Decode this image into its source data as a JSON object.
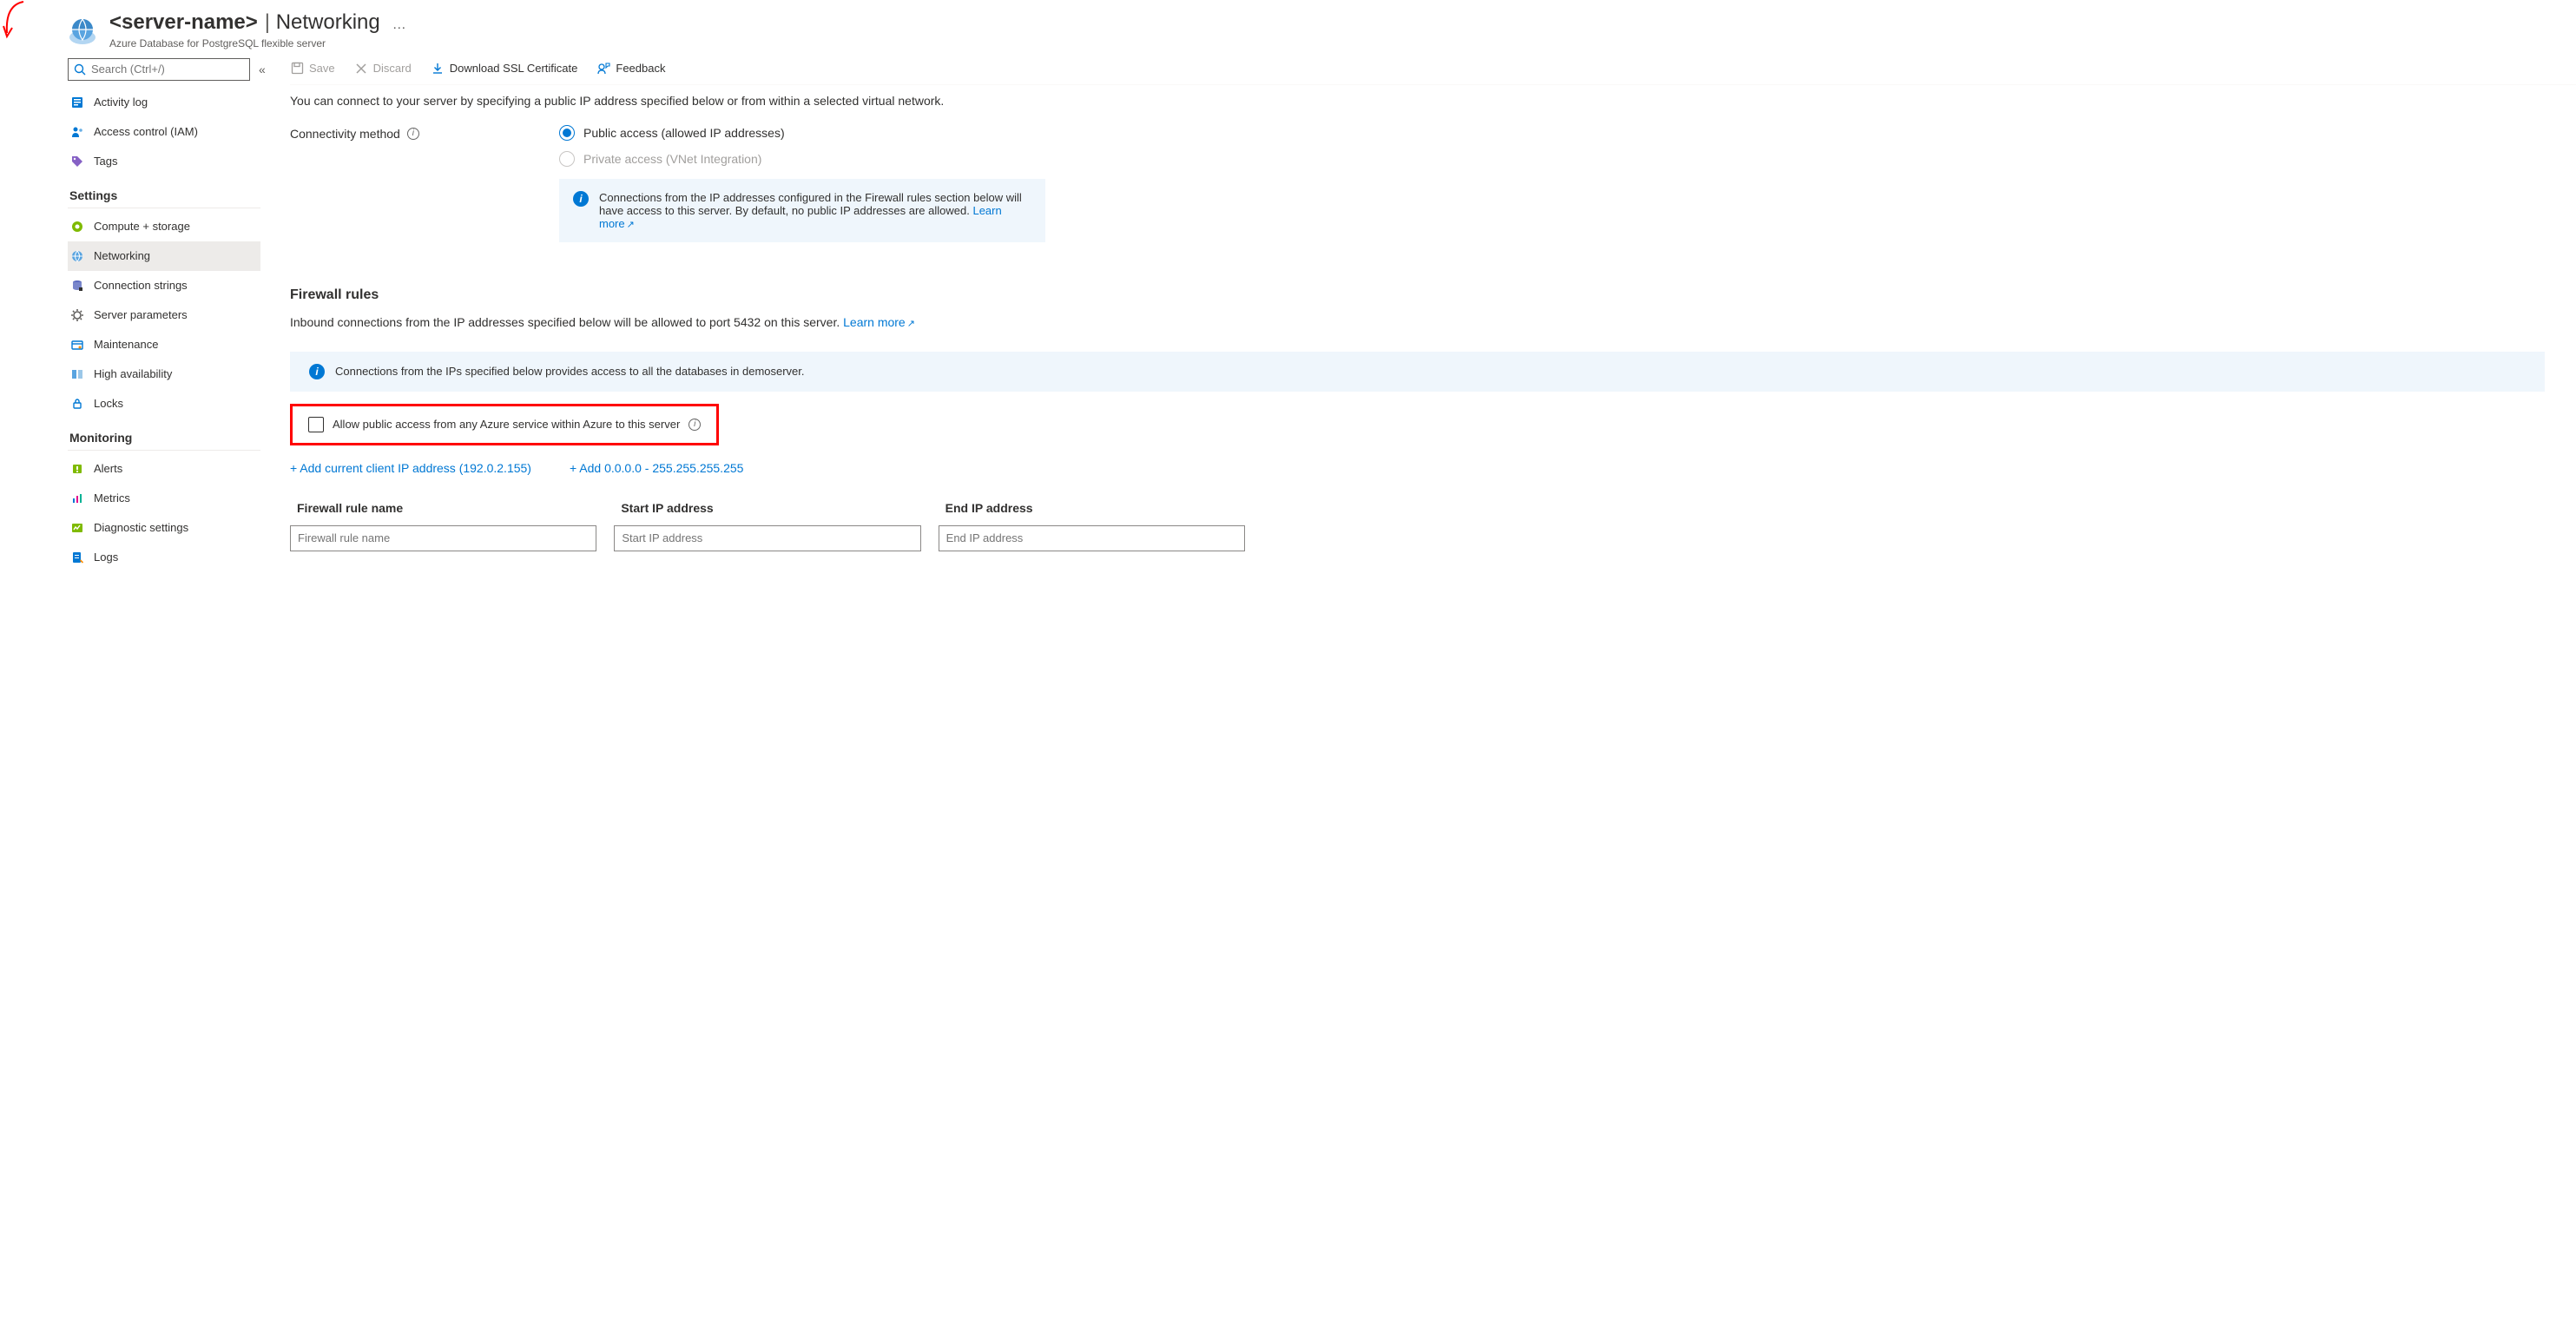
{
  "annotation_arrow": true,
  "header": {
    "server_name": "<server-name>",
    "page": "Networking",
    "subtitle": "Azure Database for PostgreSQL flexible server",
    "ellipsis": "…"
  },
  "search": {
    "placeholder": "Search (Ctrl+/)"
  },
  "sidebar": {
    "top": [
      {
        "icon": "activity-log-icon",
        "label": "Activity log"
      },
      {
        "icon": "access-control-icon",
        "label": "Access control (IAM)"
      },
      {
        "icon": "tags-icon",
        "label": "Tags"
      }
    ],
    "sections": [
      {
        "title": "Settings",
        "items": [
          {
            "icon": "compute-storage-icon",
            "label": "Compute + storage"
          },
          {
            "icon": "networking-icon",
            "label": "Networking",
            "selected": true
          },
          {
            "icon": "connection-strings-icon",
            "label": "Connection strings"
          },
          {
            "icon": "server-parameters-icon",
            "label": "Server parameters"
          },
          {
            "icon": "maintenance-icon",
            "label": "Maintenance"
          },
          {
            "icon": "high-availability-icon",
            "label": "High availability"
          },
          {
            "icon": "locks-icon",
            "label": "Locks"
          }
        ]
      },
      {
        "title": "Monitoring",
        "items": [
          {
            "icon": "alerts-icon",
            "label": "Alerts"
          },
          {
            "icon": "metrics-icon",
            "label": "Metrics"
          },
          {
            "icon": "diagnostic-settings-icon",
            "label": "Diagnostic settings"
          },
          {
            "icon": "logs-icon",
            "label": "Logs"
          }
        ]
      }
    ]
  },
  "toolbar": {
    "save": "Save",
    "discard": "Discard",
    "download_ssl": "Download SSL Certificate",
    "feedback": "Feedback"
  },
  "content": {
    "intro": "You can connect to your server by specifying a public IP address specified below or from within a selected virtual network.",
    "connectivity_label": "Connectivity method",
    "connectivity_options": [
      {
        "label": "Public access (allowed IP addresses)",
        "checked": true,
        "disabled": false
      },
      {
        "label": "Private access (VNet Integration)",
        "checked": false,
        "disabled": true
      }
    ],
    "info_callout": {
      "text": "Connections from the IP addresses configured in the Firewall rules section below will have access to this server. By default, no public IP addresses are allowed.",
      "link": "Learn more"
    },
    "firewall": {
      "heading": "Firewall rules",
      "desc_pre": "Inbound connections from the IP addresses specified below will be allowed to port 5432 on this server.",
      "desc_link": "Learn more",
      "info_bar": "Connections from the IPs specified below provides access to all the databases in demoserver.",
      "allow_azure_label": "Allow public access from any Azure service within Azure to this server",
      "add_client_label": "+ Add current client IP address (192.0.2.155)",
      "add_any_label": "+ Add 0.0.0.0 - 255.255.255.255",
      "columns": {
        "name": "Firewall rule name",
        "start": "Start IP address",
        "end": "End IP address"
      },
      "placeholders": {
        "name": "Firewall rule name",
        "start": "Start IP address",
        "end": "End IP address"
      }
    }
  }
}
